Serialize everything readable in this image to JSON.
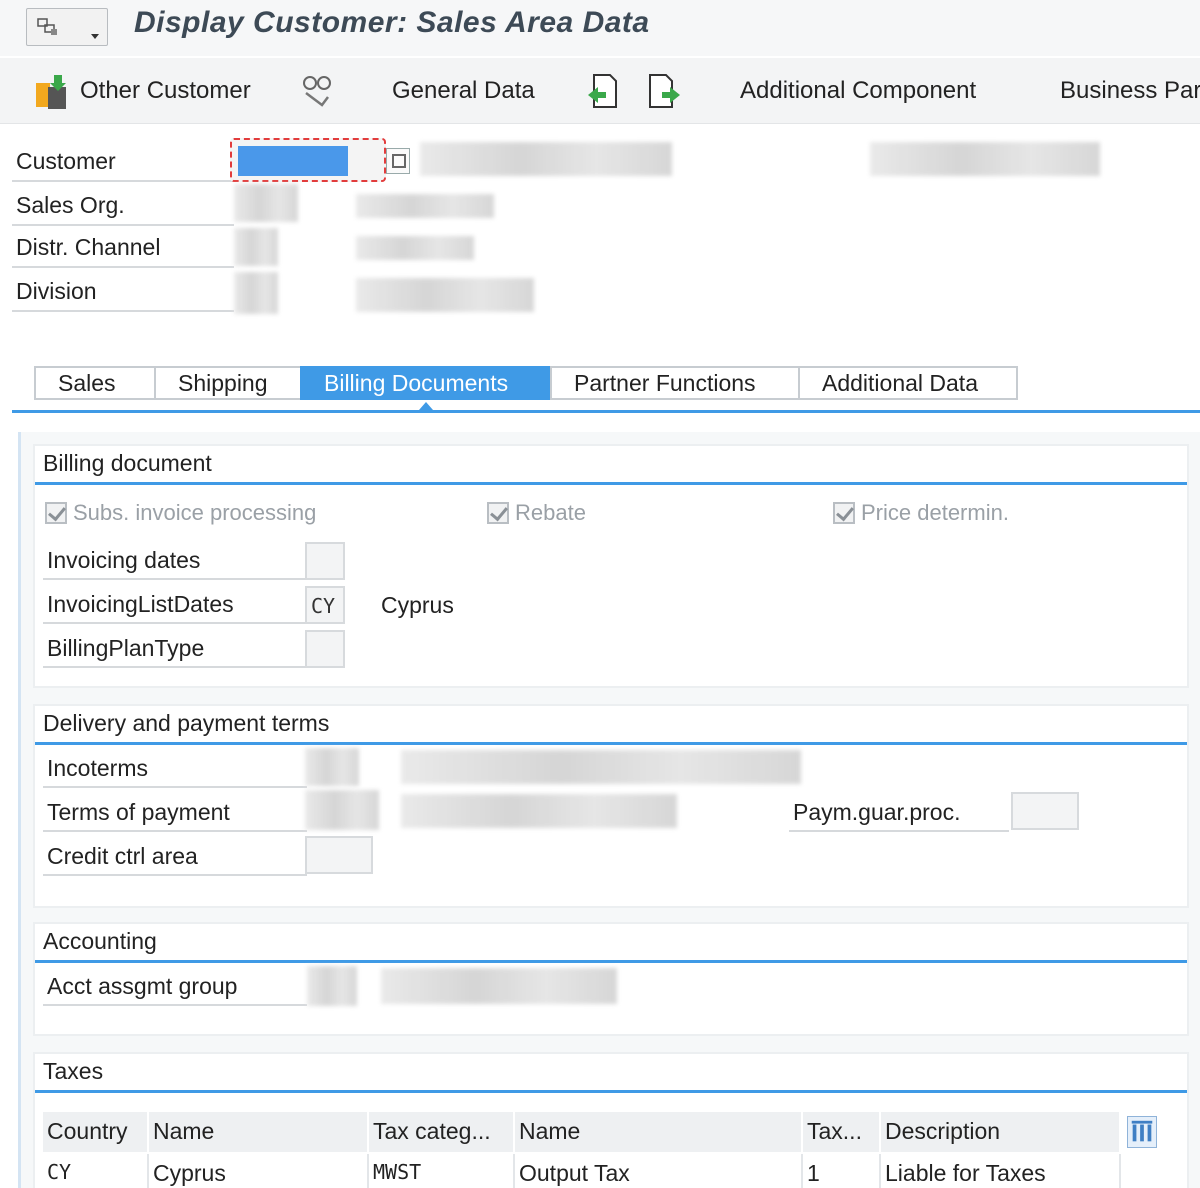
{
  "window": {
    "title": "Display Customer: Sales Area Data"
  },
  "toolbar": {
    "other_customer": "Other Customer",
    "general_data": "General Data",
    "additional_component": "Additional Component",
    "business_partner": "Business Part"
  },
  "header": {
    "customer_label": "Customer",
    "sales_org_label": "Sales Org.",
    "distr_channel_label": "Distr. Channel",
    "division_label": "Division"
  },
  "tabs": [
    {
      "label": "Sales",
      "active": false
    },
    {
      "label": "Shipping",
      "active": false
    },
    {
      "label": "Billing Documents",
      "active": true
    },
    {
      "label": "Partner Functions",
      "active": false
    },
    {
      "label": "Additional Data",
      "active": false
    }
  ],
  "billing": {
    "title": "Billing document",
    "subs_invoice": "Subs. invoice processing",
    "rebate": "Rebate",
    "price_determin": "Price determin.",
    "invoicing_dates_label": "Invoicing dates",
    "invoicing_list_dates_label": "InvoicingListDates",
    "invoicing_list_dates_value": "CY",
    "invoicing_list_dates_text": "Cyprus",
    "billing_plan_type_label": "BillingPlanType"
  },
  "delivery": {
    "title": "Delivery and payment terms",
    "incoterms_label": "Incoterms",
    "terms_of_payment_label": "Terms of payment",
    "paym_guar_label": "Paym.guar.proc.",
    "credit_ctrl_label": "Credit ctrl area"
  },
  "accounting": {
    "title": "Accounting",
    "acct_assgmt_label": "Acct assgmt group"
  },
  "taxes": {
    "title": "Taxes",
    "columns": [
      "Country",
      "Name",
      "Tax categ...",
      "Name",
      "Tax...",
      "Description"
    ],
    "rows": [
      [
        "CY",
        "Cyprus",
        "MWST",
        "Output Tax",
        "1",
        "Liable for Taxes"
      ]
    ]
  },
  "colors": {
    "accent": "#3f9ae6",
    "selection": "#4a98ea",
    "focus_border": "#e23c3c"
  },
  "icons": [
    "menu-icon",
    "other-customer-icon",
    "general-data-icon",
    "previous-page-icon",
    "next-page-icon",
    "value-help-icon",
    "column-settings-icon"
  ]
}
